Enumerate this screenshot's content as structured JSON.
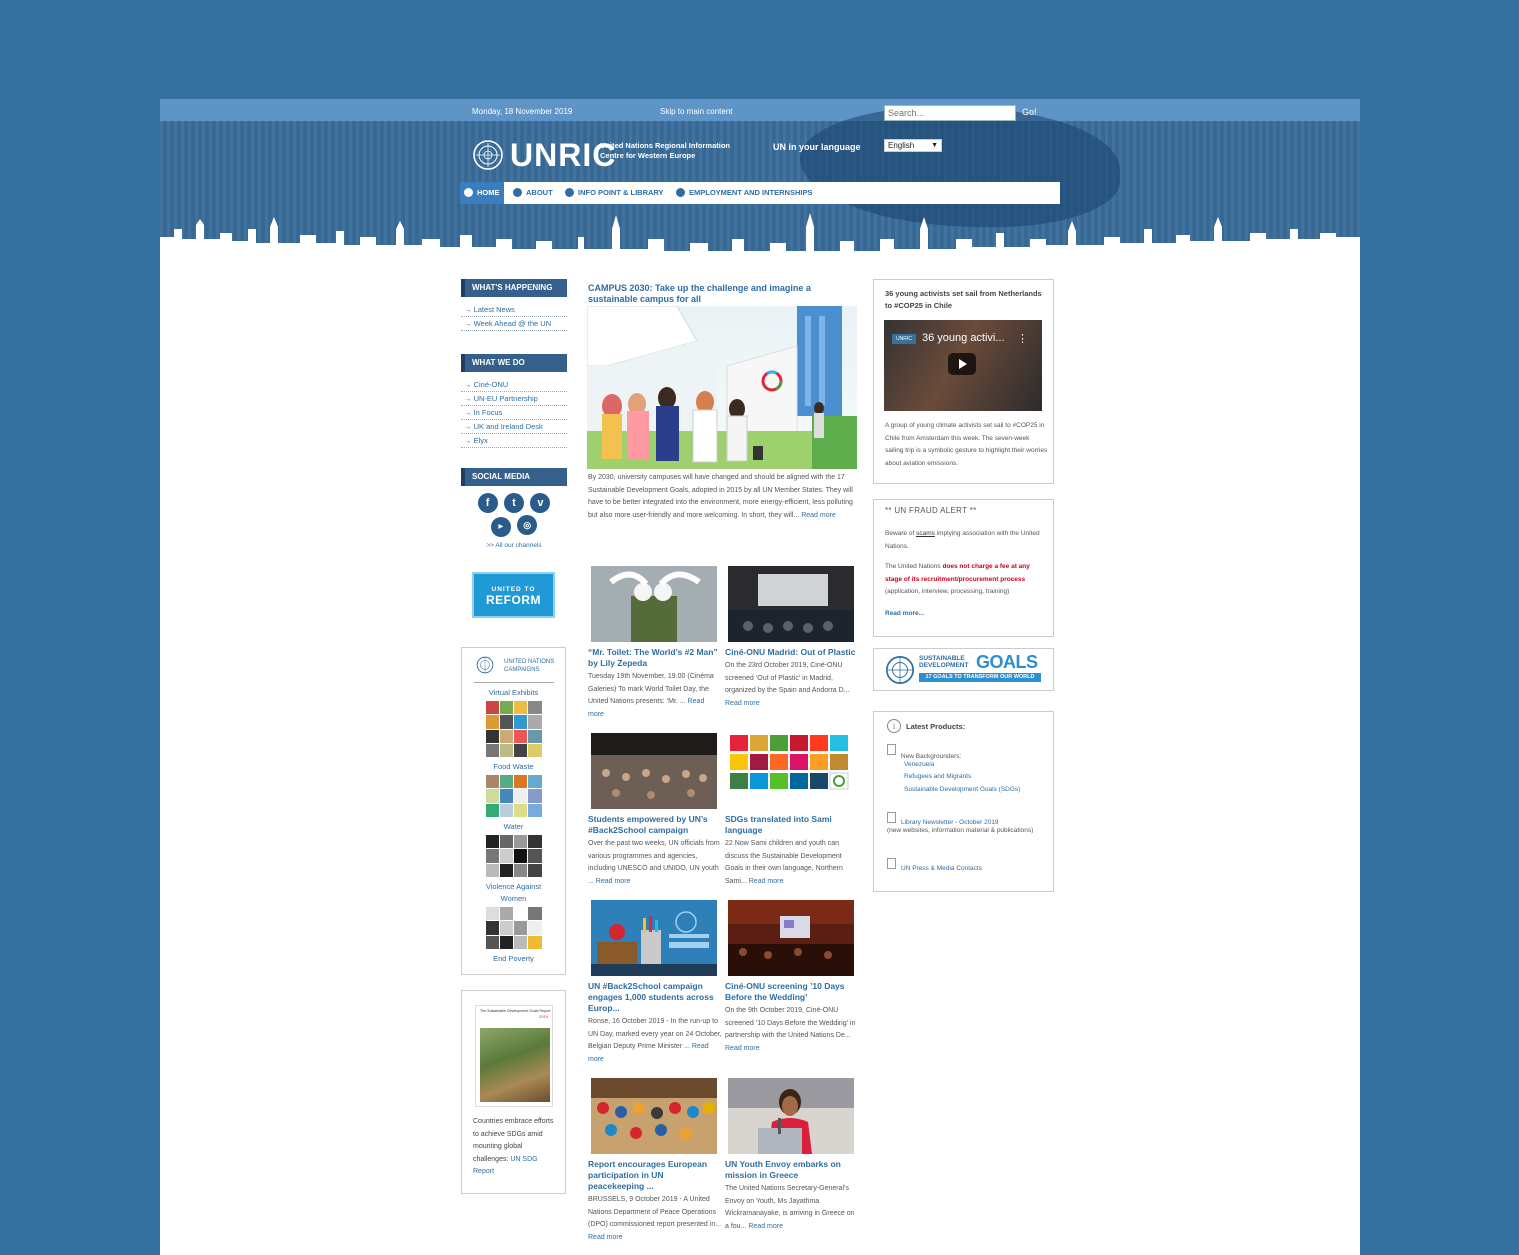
{
  "header": {
    "date": "Monday, 18 November 2019",
    "skip_link": "Skip to main content",
    "search_placeholder": "Search...",
    "search_button": "Go!",
    "logo_wordmark": "UNRIC",
    "logo_tagline": "United Nations Regional Information Centre for Western Europe",
    "language_label": "UN in your language",
    "language_selected": "English",
    "nav": [
      {
        "label": "HOME",
        "active": true
      },
      {
        "label": "ABOUT"
      },
      {
        "label": "INFO POINT & LIBRARY"
      },
      {
        "label": "EMPLOYMENT AND INTERNSHIPS"
      }
    ]
  },
  "sidebar": {
    "whats_happening": {
      "title": "WHAT'S HAPPENING",
      "links": [
        "Latest News",
        "Week Ahead @ the UN"
      ]
    },
    "what_we_do": {
      "title": "WHAT WE DO",
      "links": [
        "Ciné-ONU",
        "UN-EU Partnership",
        "In Focus",
        "UK and Ireland Desk",
        "Elyx"
      ]
    },
    "social": {
      "title": "SOCIAL MEDIA",
      "icons": [
        "facebook-icon",
        "twitter-icon",
        "vimeo-icon",
        "youtube-icon",
        "instagram-icon"
      ],
      "all_channels": ">> All our channels"
    },
    "reform_banner": {
      "line1": "UNITED TO",
      "line2": "REFORM"
    },
    "campaigns": {
      "header": "UNITED NATIONS CAMPAIGNS",
      "items": [
        "Virtual Exhibits",
        "Food Waste",
        "Water",
        "Violence Against Women",
        "End Poverty"
      ]
    },
    "sdg_report": {
      "cover_title": "The Sustainable Development Goals Report",
      "cover_year": "2019",
      "text": "Countries embrace efforts to achieve SDGs amid mounting global challenges:",
      "link": "UN SDG Report"
    }
  },
  "featured": {
    "title": "CAMPUS 2030: Take up the challenge and imagine a sustainable campus for all",
    "text": "By 2030, university campuses will have changed and should be aligned with the 17 Sustainable Development Goals, adopted in 2015 by all UN Member States. They will have to be better integrated into the environment, more energy-efficient, less polluting but also more user-friendly and more welcoming. In short, they will...",
    "read_more": "Read more"
  },
  "articles": [
    {
      "title": "“Mr. Toilet: The World’s #2 Man” by Lily Zepeda",
      "text": "Tuesday 19th November, 19.00 (Cinéma Galeries) To mark World Toilet Day, the United Nations presents: ‘Mr. ...",
      "read_more": "Read more"
    },
    {
      "title": "Ciné-ONU Madrid: Out of Plastic",
      "text": "On the 23rd October 2019, Ciné-ONU screened ‘Out of Plastic’ in Madrid, organized by the Spain and Andorra D...",
      "read_more": "Read more"
    },
    {
      "title": "Students empowered by UN’s #Back2School campaign",
      "text": "Over the past two weeks, UN officials from various programmes and agencies, including UNESCO and UNIDO, UN youth ...",
      "read_more": "Read more"
    },
    {
      "title": "SDGs translated into Sami language",
      "text": "22 Now Sami children and youth can discuss the Sustainable Development Goals in their own language, Northern Sami...",
      "read_more": "Read more"
    },
    {
      "title": "UN #Back2School campaign engages 1,000 students across Europ...",
      "text": "Ronse, 16 October 2019 - In the run-up to UN Day, marked every year on 24 October, Belgian Deputy Prime Minister ...",
      "read_more": "Read more"
    },
    {
      "title": "Ciné-ONU screening ’10 Days Before the Wedding’",
      "text": "On the 9th October 2019, Ciné-ONU screened ’10 Days Before the Wedding’ in partnership with the United Nations De...",
      "read_more": "Read more"
    },
    {
      "title": "Report encourages European participation in UN peacekeeping ...",
      "text": "BRUSSELS, 9 October 2019 - A United Nations Department of Peace Operations (DPO) commissioned report presented in...",
      "read_more": "Read more"
    },
    {
      "title": "UN Youth Envoy embarks on mission in Greece",
      "text": "The United Nations Secretary-General’s Envoy on Youth, Ms Jayathma Wickramanayake, is arriving in Greece on a fou...",
      "read_more": "Read more"
    }
  ],
  "right": {
    "video": {
      "title": "36 young activists set sail from Netherlands to #COP25 in Chile",
      "player_label": "36 young activi...",
      "player_logo": "UNRIC",
      "description": "A group of young climate activists set sail to #COP25 in Chile from Amsterdam this week. The seven-week sailing trip is a symbolic gesture to highlight their worries about aviation emissions."
    },
    "fraud": {
      "title": "** UN FRAUD ALERT **",
      "p1_a": "Beware of ",
      "p1_scams": "scams",
      "p1_b": " implying association with the United Nations.",
      "p2_a": "The United Nations ",
      "p2_red": "does not charge a fee at any stage of its recruitment/procurement process",
      "p2_b": " (application, interview, processing, training)",
      "read_more": "Read more..."
    },
    "sdg_banner": {
      "line1": "SUSTAINABLE DEVELOPMENT",
      "line2": "GOALS",
      "line3": "17 GOALS TO TRANSFORM OUR WORLD"
    },
    "products": {
      "title": "Latest Products:",
      "backgrounders_label": "New Backgrounders:",
      "backgrounders": [
        "Venezuela",
        "Refugees and Migrants",
        "Sustainable Development Goals (SDGs)"
      ],
      "newsletter": "Library Newsletter - October 2019",
      "newsletter_note": "(new websites, information material & publications)",
      "press": "UN Press & Media Contacts"
    }
  },
  "colors": {
    "background": "#36709e",
    "header": "#3a6d9a",
    "link": "#2e6da4",
    "nav_active": "#3a7ebf",
    "alert_red": "#d0021b"
  }
}
